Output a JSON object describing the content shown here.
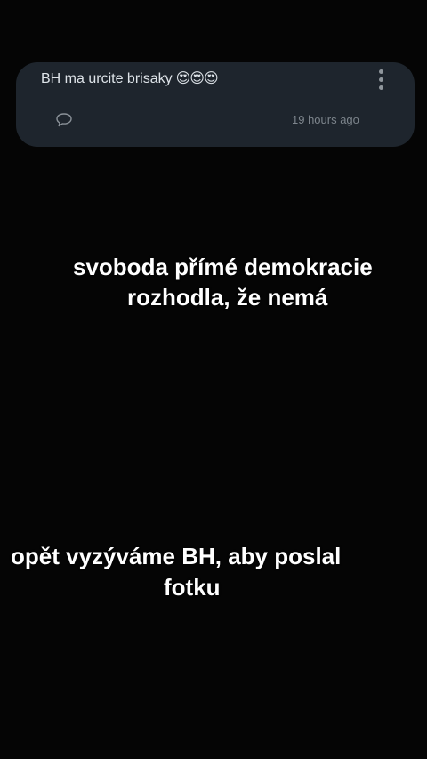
{
  "comment": {
    "text": "BH ma urcite brisaky",
    "emojis": "😍😍😍",
    "time": "19 hours ago",
    "icons": [
      "comment-icon",
      "more-vert-icon"
    ]
  },
  "captions": {
    "first_line1": "svoboda přímé demokracie",
    "first_line2": "rozhodla, že nemá",
    "second_line1": "opět vyzýváme BH, aby poslal",
    "second_line2": "fotku"
  },
  "colors": {
    "background": "#050505",
    "card": "#1e252d",
    "text": "#ffffff"
  }
}
